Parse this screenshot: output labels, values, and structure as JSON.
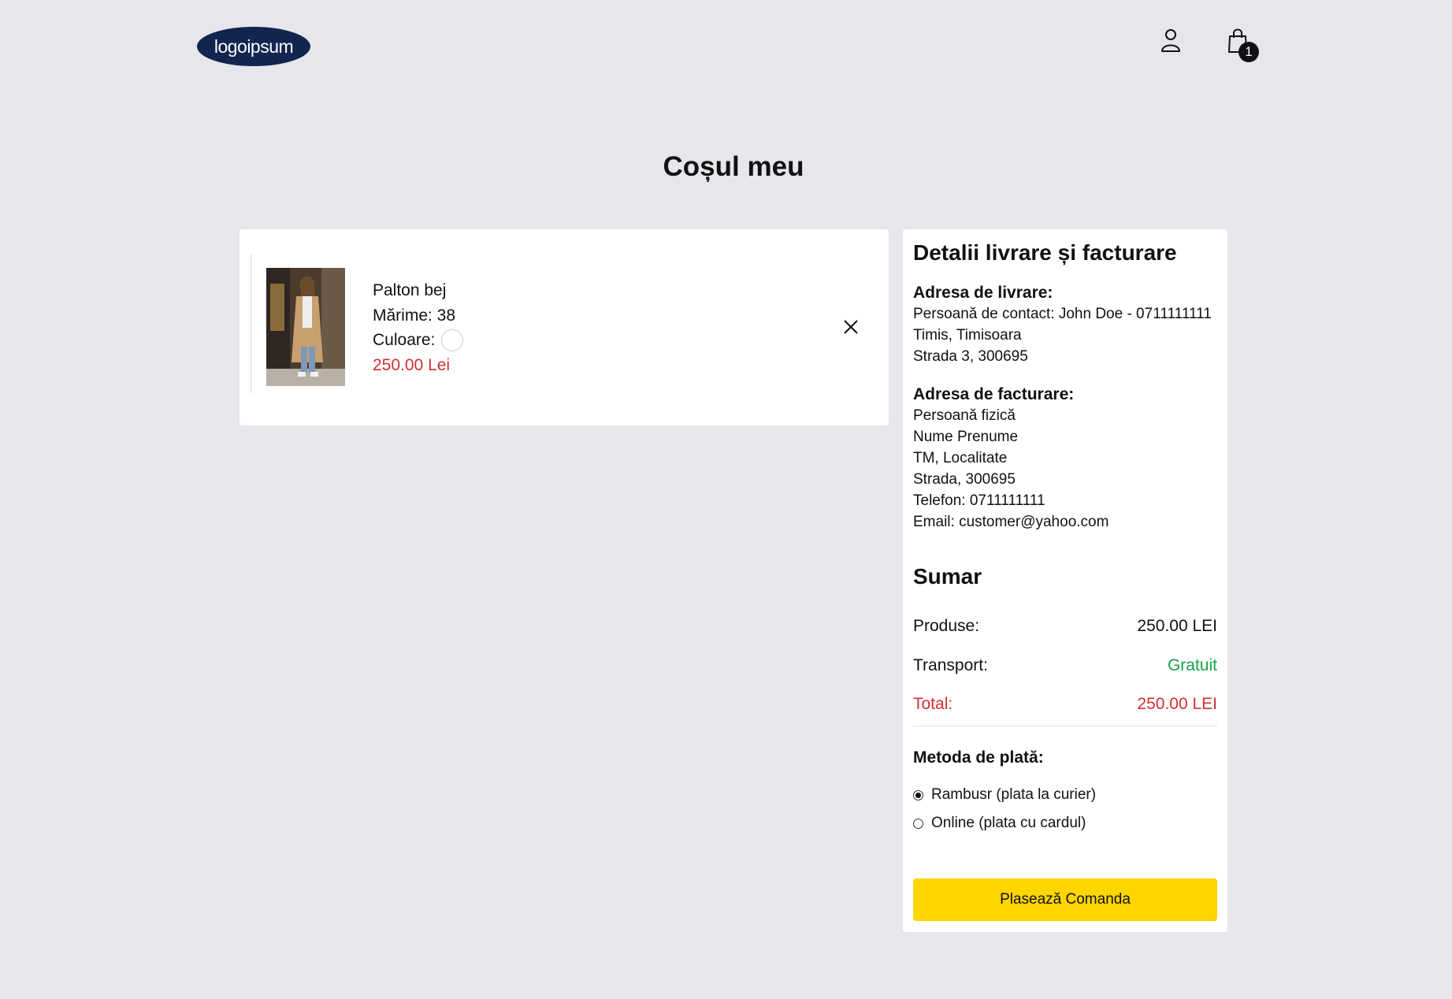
{
  "header": {
    "logo_text": "logoipsum",
    "user_icon": "user-icon",
    "cart_icon": "shopping-bag-icon",
    "cart_count": "1"
  },
  "page_title": "Coșul meu",
  "cart": {
    "items": [
      {
        "name": "Palton bej",
        "size_label": "Mărime: 38",
        "color_label": "Culoare:",
        "color_value": "#ffffff",
        "price": "250.00 Lei",
        "remove_icon": "close-icon"
      }
    ]
  },
  "details": {
    "title": "Detalii livrare și facturare",
    "shipping": {
      "heading": "Adresa de livrare:",
      "lines": [
        "Persoană de contact: John Doe - 0711111111",
        "Timis, Timisoara",
        "Strada 3, 300695"
      ]
    },
    "billing": {
      "heading": "Adresa de facturare:",
      "lines": [
        "Persoană fizică",
        "Nume Prenume",
        "TM, Localitate",
        "Strada, 300695",
        "Telefon: 0711111111",
        "Email: customer@yahoo.com"
      ]
    }
  },
  "summary": {
    "title": "Sumar",
    "products_label": "Produse:",
    "products_value": "250.00 LEI",
    "shipping_label": "Transport:",
    "shipping_value": "Gratuit",
    "total_label": "Total:",
    "total_value": "250.00 LEI"
  },
  "payment": {
    "title": "Metoda de plată:",
    "options": [
      {
        "label": "Rambusr (plata la curier)",
        "selected": true
      },
      {
        "label": "Online (plata cu cardul)",
        "selected": false
      }
    ]
  },
  "place_order_label": "Plasează Comanda",
  "colors": {
    "background": "#e5e7eb",
    "logo": "#13254f",
    "price_red": "#d32f2f",
    "free_green": "#16a34a",
    "button_yellow": "#ffd500"
  }
}
